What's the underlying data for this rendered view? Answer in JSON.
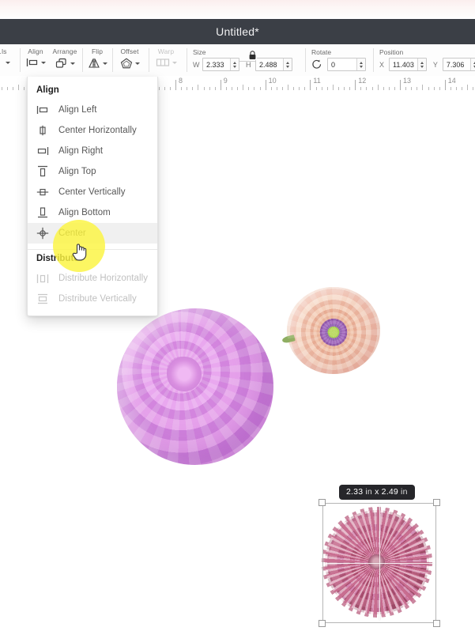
{
  "window": {
    "title": "Untitled*"
  },
  "toolbar": {
    "groups": [
      {
        "label": "Align",
        "icon": "align-left-icon",
        "disabled": false
      },
      {
        "label": "Arrange",
        "icon": "arrange-icon",
        "disabled": false
      },
      {
        "label": "Flip",
        "icon": "flip-icon",
        "disabled": false
      },
      {
        "label": "Offset",
        "icon": "offset-icon",
        "disabled": false
      },
      {
        "label": "Warp",
        "icon": "warp-icon",
        "disabled": true
      }
    ],
    "size": {
      "title": "Size",
      "width_key": "W",
      "width_value": "2.333",
      "height_key": "H",
      "height_value": "2.488",
      "lock_icon": "lock-icon"
    },
    "rotate": {
      "title": "Rotate",
      "icon": "rotate-icon",
      "value": "0"
    },
    "position": {
      "title": "Position",
      "x_key": "X",
      "x_value": "11.403",
      "y_key": "Y",
      "y_value": "7.306"
    }
  },
  "ruler": {
    "unit": "in",
    "labels": [
      "8",
      "9",
      "10",
      "11",
      "12",
      "13",
      "14"
    ]
  },
  "align_menu": {
    "sections": [
      {
        "title": "Align",
        "items": [
          {
            "label": "Align Left",
            "icon": "align-left-icon",
            "state": "normal"
          },
          {
            "label": "Center Horizontally",
            "icon": "center-horizontal-icon",
            "state": "normal"
          },
          {
            "label": "Align Right",
            "icon": "align-right-icon",
            "state": "normal"
          },
          {
            "label": "Align Top",
            "icon": "align-top-icon",
            "state": "normal"
          },
          {
            "label": "Center Vertically",
            "icon": "center-vertical-icon",
            "state": "normal"
          },
          {
            "label": "Align Bottom",
            "icon": "align-bottom-icon",
            "state": "normal"
          },
          {
            "label": "Center",
            "icon": "center-icon",
            "state": "highlight"
          }
        ]
      },
      {
        "title": "Distribute",
        "items": [
          {
            "label": "Distribute Horizontally",
            "icon": "distribute-horizontal-icon",
            "state": "disabled"
          },
          {
            "label": "Distribute Vertically",
            "icon": "distribute-vertical-icon",
            "state": "disabled"
          }
        ]
      }
    ]
  },
  "canvas": {
    "size_tooltip": {
      "width": "2.33",
      "unit_1": "in",
      "separator": "x",
      "height": "2.49",
      "unit_2": "in",
      "full_text": "2.33 in x 2.49 in"
    },
    "objects": [
      {
        "name": "purple-dahlia",
        "type": "image"
      },
      {
        "name": "peach-dahlia",
        "type": "image"
      },
      {
        "name": "magenta-dahlia",
        "type": "image",
        "selected": true
      }
    ]
  },
  "colors": {
    "titlebar_bg": "#3b3f46",
    "titlebar_text": "#f1f1f2",
    "toolbar_bg": "#fdfdfd",
    "menu_bg": "#ffffff",
    "menu_highlight": "#f0f0f0",
    "menu_text": "#565656",
    "menu_disabled_text": "#c0c0c0",
    "click_highlight": "#fbf43f",
    "tooltip_bg": "#26262a",
    "selection_handle_border": "#9a9a9a"
  }
}
